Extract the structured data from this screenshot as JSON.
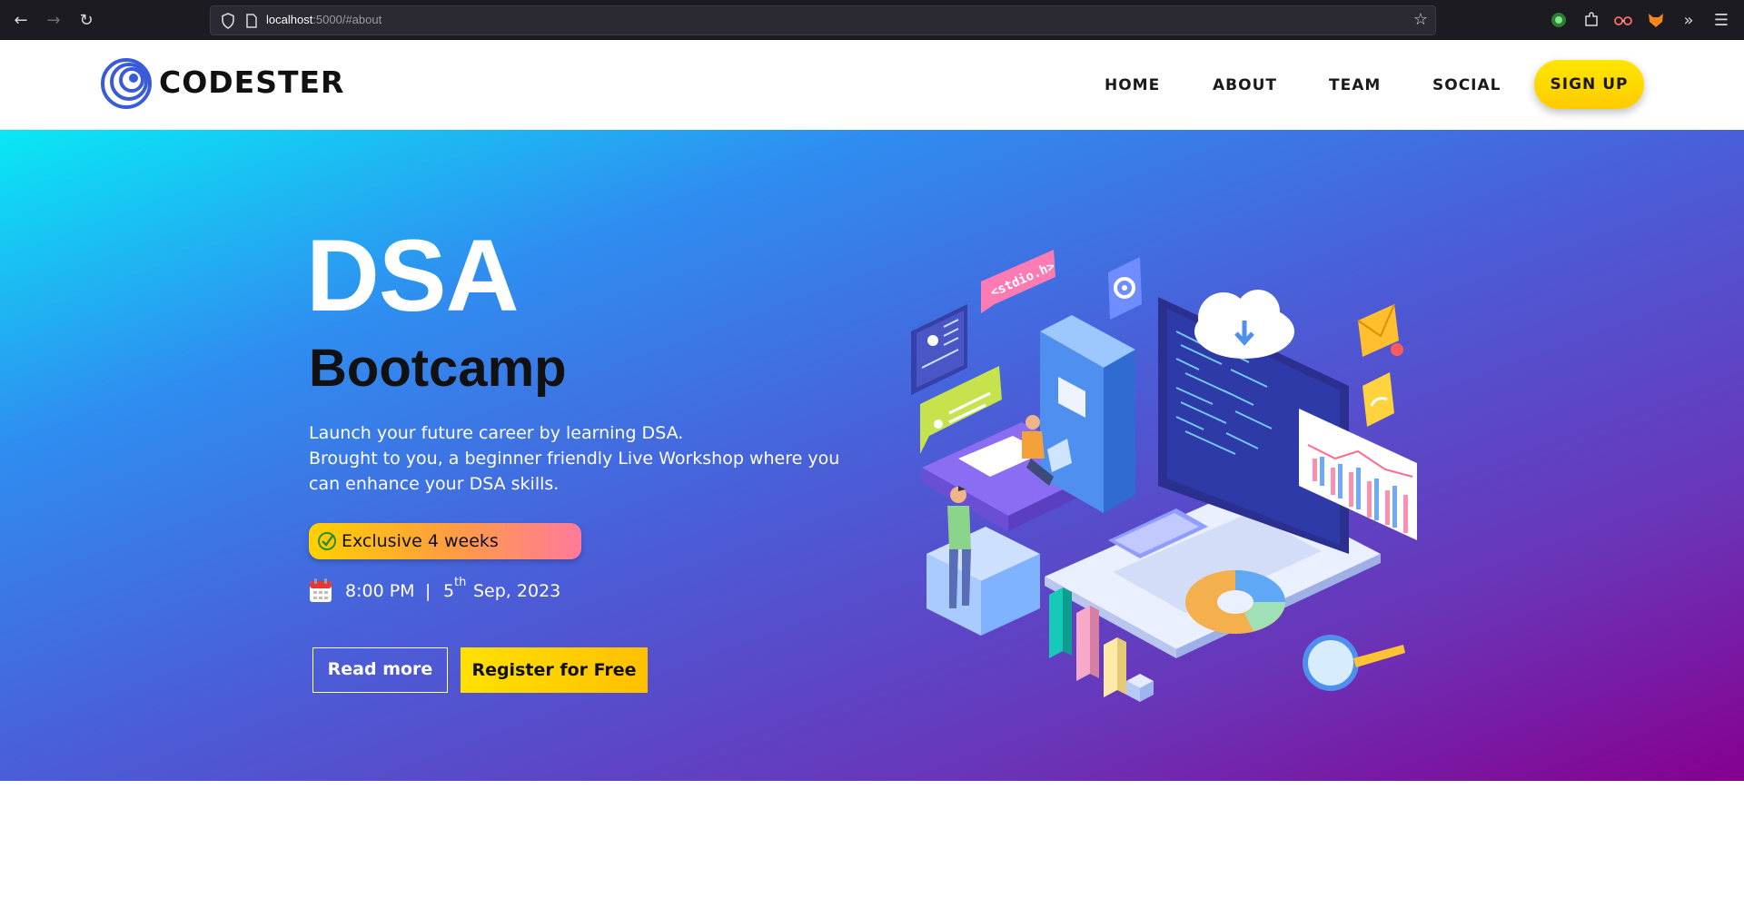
{
  "browser": {
    "url_host": "localhost",
    "url_rest": ":5000/#about"
  },
  "navbar": {
    "brand": "CODESTER",
    "links": [
      "HOME",
      "ABOUT",
      "TEAM",
      "SOCIAL"
    ],
    "signup_label": "SIGN UP"
  },
  "hero": {
    "title": "DSA",
    "subtitle": "Bootcamp",
    "description_lines": [
      "Launch your future career by learning DSA.",
      "Brought to you, a beginner friendly Live Workshop where you",
      "can enhance your DSA skills."
    ],
    "badge": "Exclusive 4 weeks",
    "time": "8:00 PM",
    "separator": "|",
    "date_day": "5",
    "date_suffix": "th",
    "date_rest": "Sep, 2023",
    "read_more_label": "Read more",
    "register_label": "Register for Free",
    "illustration_label": "<stdio.h>"
  },
  "colors": {
    "hero_gradient": [
      "#09e8f5",
      "#4a5ed8",
      "#86008f"
    ],
    "accent_yellow": "#ffd600",
    "chrome_bg": "#1c1b22"
  },
  "icons": {
    "chrome": [
      "back-icon",
      "forward-icon",
      "reload-icon",
      "shield-icon",
      "page-icon",
      "bookmark-star-icon",
      "extension-icon",
      "overflow-icon",
      "menu-icon"
    ],
    "hero": [
      "checkmark-icon",
      "calendar-icon"
    ]
  }
}
